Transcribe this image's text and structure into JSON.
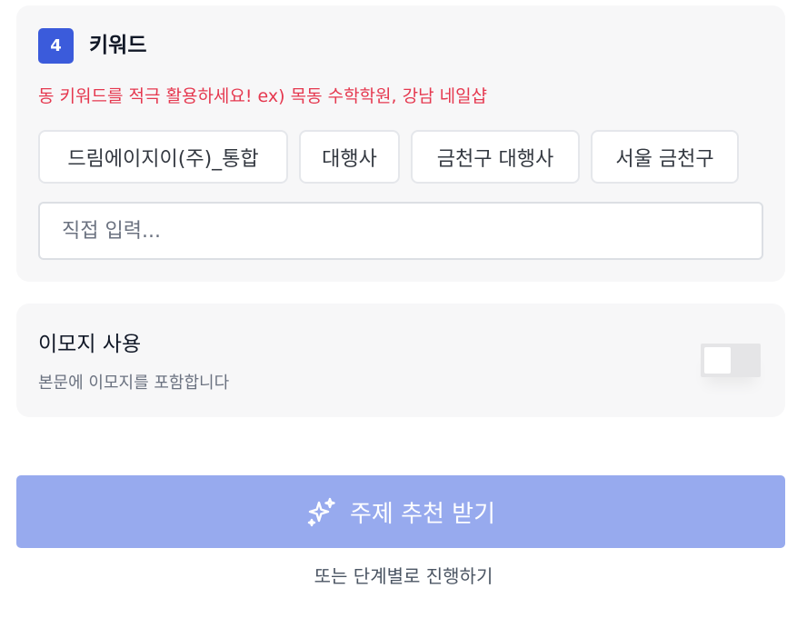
{
  "keyword_section": {
    "step_number": "4",
    "title": "키워드",
    "hint": "동 키워드를 적극 활용하세요! ex) 목동 수학학원, 강남 네일샵",
    "chips": [
      "드림에이지이(주)_통합",
      "대행사",
      "금천구 대행사",
      "서울 금천구"
    ],
    "input": {
      "value": "",
      "placeholder": "직접 입력..."
    }
  },
  "emoji_section": {
    "title": "이모지 사용",
    "description": "본문에 이모지를 포함합니다",
    "toggle_on": false
  },
  "actions": {
    "primary_label": "주제 추천 받기",
    "primary_icon": "sparkles-icon",
    "secondary_label": "또는 단계별로 진행하기"
  },
  "colors": {
    "accent": "#3b5bdb",
    "primary_button": "#97aaee",
    "hint_text": "#e5384f"
  }
}
